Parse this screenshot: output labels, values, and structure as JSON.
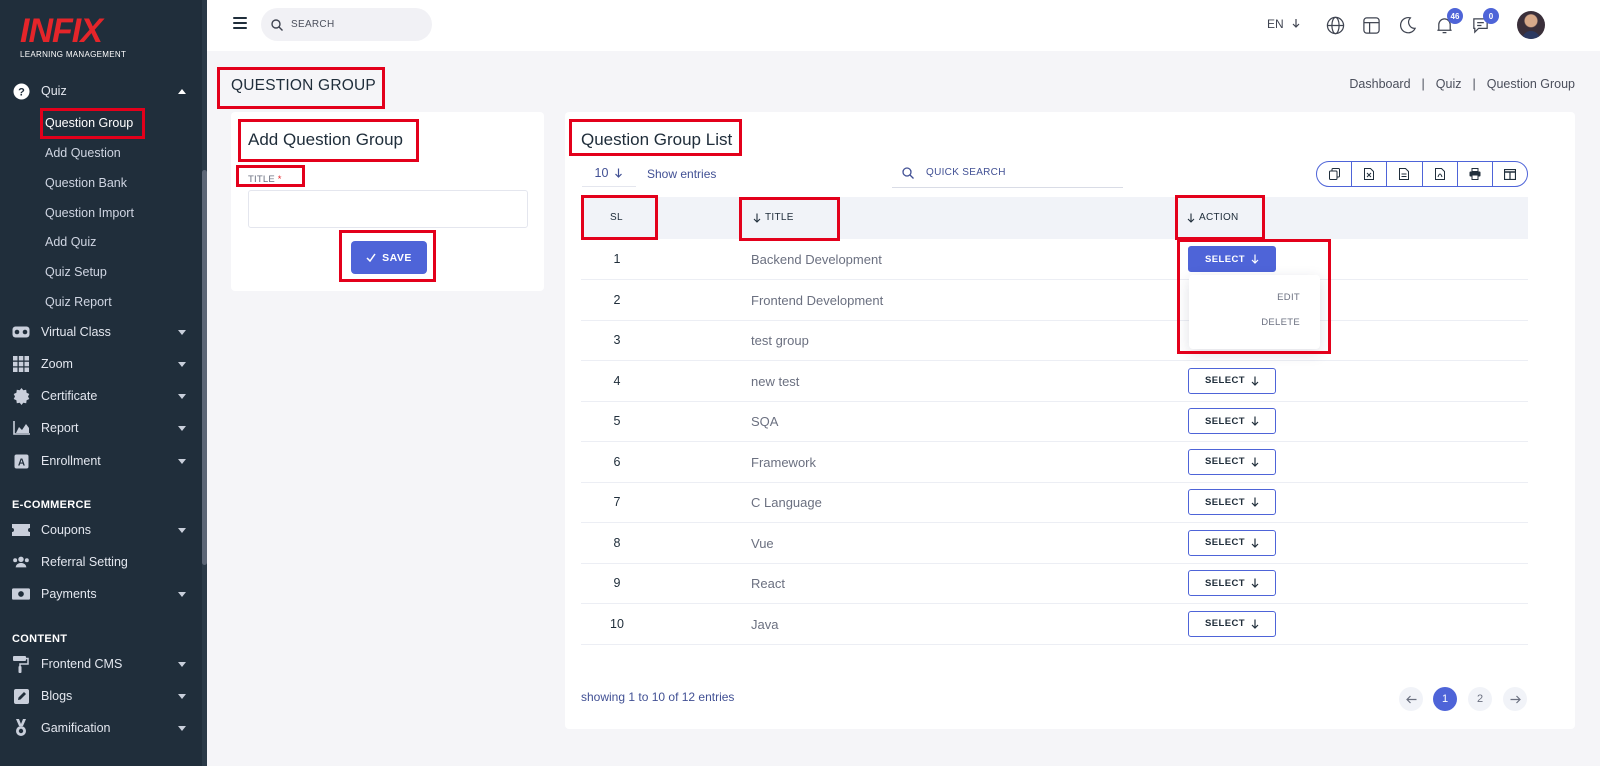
{
  "brand": {
    "logo": "INFIX",
    "tagline": "LEARNING MANAGEMENT"
  },
  "header": {
    "search_placeholder": "SEARCH",
    "language": "EN",
    "notifications_count": "46",
    "messages_count": "0"
  },
  "sidebar": {
    "quiz": {
      "label": "Quiz",
      "children": [
        "Question Group",
        "Add Question",
        "Question Bank",
        "Question Import",
        "Add Quiz",
        "Quiz Setup",
        "Quiz Report"
      ]
    },
    "items": [
      "Virtual Class",
      "Zoom",
      "Certificate",
      "Report",
      "Enrollment"
    ],
    "ecommerce_heading": "E-COMMERCE",
    "ecommerce": [
      "Coupons",
      "Referral Setting",
      "Payments"
    ],
    "content_heading": "CONTENT",
    "content": [
      "Frontend CMS",
      "Blogs",
      "Gamification"
    ]
  },
  "page": {
    "title": "QUESTION GROUP",
    "breadcrumb": [
      "Dashboard",
      "Quiz",
      "Question Group"
    ]
  },
  "form": {
    "title": "Add Question Group",
    "label": "TITLE",
    "required_mark": "*",
    "value": "",
    "save_label": "SAVE"
  },
  "list": {
    "title": "Question Group List",
    "entries": "10",
    "show_entries": "Show entries",
    "search_placeholder": "QUICK SEARCH",
    "columns": {
      "sl": "SL",
      "title": "TITLE",
      "action": "ACTION"
    },
    "rows": [
      {
        "sl": "1",
        "title": "Backend Development"
      },
      {
        "sl": "2",
        "title": "Frontend Development"
      },
      {
        "sl": "3",
        "title": "test group"
      },
      {
        "sl": "4",
        "title": "new test"
      },
      {
        "sl": "5",
        "title": "SQA"
      },
      {
        "sl": "6",
        "title": "Framework"
      },
      {
        "sl": "7",
        "title": "C Language"
      },
      {
        "sl": "8",
        "title": "Vue"
      },
      {
        "sl": "9",
        "title": "React"
      },
      {
        "sl": "10",
        "title": "Java"
      }
    ],
    "select_label": "SELECT",
    "menu": {
      "edit": "EDIT",
      "delete": "DELETE"
    },
    "showing": "showing 1 to 10 of 12 entries",
    "pages": [
      "1",
      "2"
    ]
  },
  "colors": {
    "accent": "#4e64d8",
    "sidebar": "#202e3b",
    "highlight": "#e3001b",
    "brand": "#e5252a"
  }
}
